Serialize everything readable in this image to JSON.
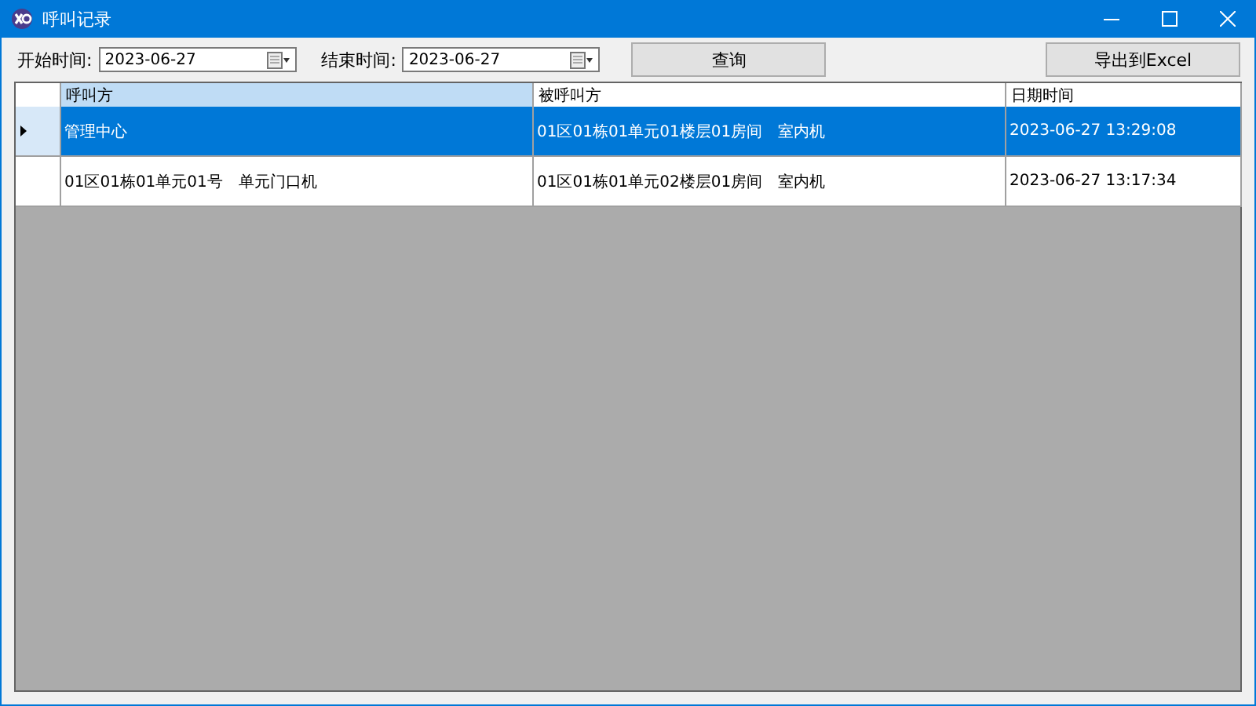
{
  "window": {
    "title": "呼叫记录"
  },
  "filters": [
    {
      "label": "开始时间:",
      "value": "2023-06-27"
    },
    {
      "label": "结束时间:",
      "value": "2023-06-27"
    }
  ],
  "buttons": [
    {
      "kind": "query",
      "label": "查询"
    },
    {
      "kind": "export",
      "label": "导出到Excel"
    }
  ],
  "table": {
    "columns": [
      {
        "label": "呼叫方",
        "selected": true
      },
      {
        "label": "被呼叫方",
        "selected": false
      },
      {
        "label": "日期时间",
        "selected": false
      }
    ],
    "rows": [
      {
        "selected": true,
        "cells": [
          "管理中心",
          "01区01栋01单元01楼层01房间　室内机",
          "2023-06-27 13:29:08"
        ]
      },
      {
        "selected": false,
        "cells": [
          "01区01栋01单元01号　单元门口机",
          "01区01栋01单元02楼层01房间　室内机",
          "2023-06-27 13:17:34"
        ]
      }
    ]
  }
}
